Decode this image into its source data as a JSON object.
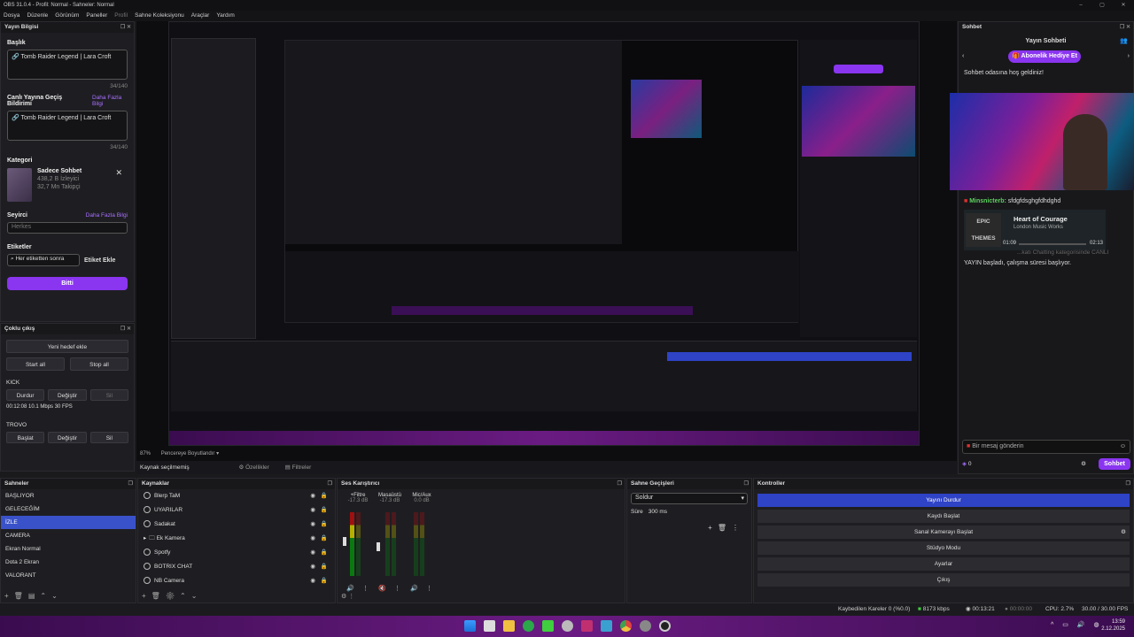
{
  "window": {
    "title": "OBS 31.0.4 - Profil: Normal - Sahneler: Normal"
  },
  "menu": [
    "Dosya",
    "Düzenle",
    "Görünüm",
    "Paneller",
    "Profil",
    "Sahne Koleksiyonu",
    "Araçlar",
    "Yardım"
  ],
  "stream_info": {
    "panel_title": "Yayın Bilgisi",
    "title_label": "Başlık",
    "title_value": "🔗 Tomb Raider Legend | Lara Croft",
    "title_counter": "34/140",
    "notif_label": "Canlı Yayına Geçiş Bildirimi",
    "notif_more": "Daha Fazla Bilgi",
    "notif_value": "🔗 Tomb Raider Legend | Lara Croft",
    "notif_counter": "34/140",
    "category_label": "Kategori",
    "category_name": "Sadece Sohbet",
    "category_viewers": "438,2 B İzleyici",
    "category_followers": "32,7 Mn Takipçi",
    "audience_label": "Seyirci",
    "audience_more": "Daha Fazla Bilgi",
    "audience_value": "Herkes",
    "tags_label": "Etiketler",
    "tags_placeholder": "Her etiketten sonra",
    "tags_add": "Etiket Ekle",
    "done": "Bitti"
  },
  "multi": {
    "panel_title": "Çoklu çıkış",
    "new_target": "Yeni hedef ekle",
    "start_all": "Start all",
    "stop_all": "Stop all",
    "kick_label": "KICK",
    "kick_stop": "Durdur",
    "kick_edit": "Değiştir",
    "kick_delete": "Sil",
    "kick_stats": "00:12:08  10.1 Mbps  30 FPS",
    "trovo_label": "TROVO",
    "trovo_start": "Başlat",
    "trovo_edit": "Değiştir",
    "trovo_delete": "Sil"
  },
  "preview": {
    "zoom": "87%",
    "mode": "Pencereye Boyutlandır",
    "no_source": "Kaynak seçilmemiş",
    "properties": "Özellikler",
    "filters": "Filtreler"
  },
  "chat": {
    "panel_title": "Sohbet",
    "header": "Yayın Sohbeti",
    "gift_button": "Abonelik Hediye Et",
    "welcome": "Sohbet odasına hoş geldiniz!",
    "msg_user": "Minsnicterb:",
    "msg_text": "sfdgfdsghgfdhdghd",
    "song_title": "Heart of Courage",
    "song_artist": "London Music Works",
    "song_elapsed": "01:09",
    "song_total": "02:13",
    "song_art": "EPIC THEMES",
    "msg_partial": "...katı Chatting kategorisinde CANLI",
    "msg_system": "YAYIN başladı, çalışma süresi başlıyor.",
    "input_placeholder": "Bir mesaj gönderin",
    "points": "0",
    "send": "Sohbet"
  },
  "scenes": {
    "panel_title": "Sahneler",
    "items": [
      "BAŞLIYOR",
      "GELECEĞİM",
      "İZLE",
      "CAMERA",
      "Ekran Normal",
      "Dota 2 Ekran",
      "VALORANT"
    ],
    "selected": 2
  },
  "sources": {
    "panel_title": "Kaynaklar",
    "items": [
      "Blerp TaM",
      "UYARILAR",
      "Sadakat",
      "Ek Kamera",
      "Spotfy",
      "BOTRIX CHAT",
      "NB Camera"
    ]
  },
  "mixer": {
    "panel_title": "Ses Karıştırıcı",
    "channels": [
      {
        "name": "+Filtre",
        "db": "-17.3 dB"
      },
      {
        "name": "Masaüstü",
        "db": "-17.3 dB"
      },
      {
        "name": "Mic/Aux",
        "db": "0.0 dB"
      }
    ]
  },
  "transitions": {
    "panel_title": "Sahne Geçişleri",
    "type": "Soldur",
    "duration_label": "Süre",
    "duration_value": "300 ms"
  },
  "controls": {
    "panel_title": "Kontroller",
    "buttons": [
      "Yayını Durdur",
      "Kaydı Başlat",
      "Sanal Kamerayı Başlat",
      "Stüdyo Modu",
      "Ayarlar",
      "Çıkış"
    ]
  },
  "status": {
    "dropped": "Kaybedilen Kareler 0 (%0.0)",
    "bitrate": "8173 kbps",
    "stream_time": "00:13:21",
    "rec_time": "00:00:00",
    "cpu": "CPU: 2.7%",
    "fps": "30.00 / 30.00 FPS"
  },
  "clock": {
    "time": "13:59",
    "date": "2.12.2025"
  },
  "colors": {
    "accent": "#8a35f0",
    "selected": "#3a52c9",
    "taskbar": "#6a1b82"
  }
}
